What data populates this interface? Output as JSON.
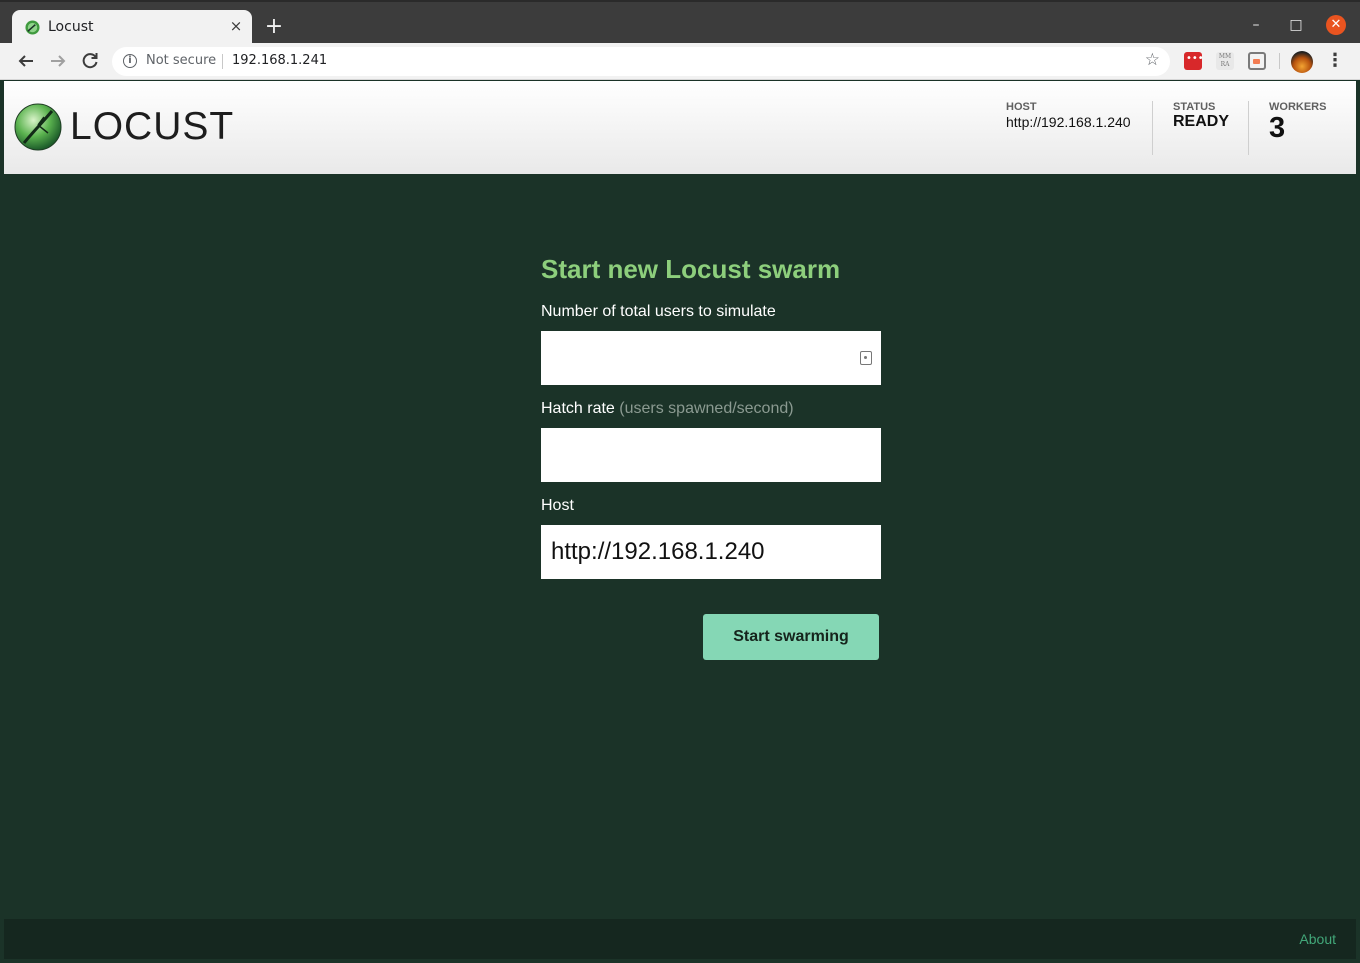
{
  "browser": {
    "tab_title": "Locust",
    "tab_close": "×",
    "new_tab": "+",
    "security_label": "Not secure",
    "url": "192.168.1.241",
    "window_controls": {
      "minimize": "–",
      "maximize": "□",
      "close": "✕"
    },
    "extensions": [
      "lastpass-icon",
      "mmra-extension-icon",
      "cast-icon"
    ],
    "ext2_text": "MM\nRA"
  },
  "header": {
    "logo_text": "LOCUST",
    "host": {
      "label": "HOST",
      "value": "http://192.168.1.240"
    },
    "status": {
      "label": "STATUS",
      "value": "READY"
    },
    "workers": {
      "label": "WORKERS",
      "value": "3"
    }
  },
  "form": {
    "title": "Start new Locust swarm",
    "users_label": "Number of total users to simulate",
    "users_value": "",
    "hatch_label": "Hatch rate",
    "hatch_hint": "(users spawned/second)",
    "hatch_value": "",
    "host_label": "Host",
    "host_value": "http://192.168.1.240",
    "submit_label": "Start swarming"
  },
  "footer": {
    "about_label": "About"
  },
  "colors": {
    "page_bg": "#1b3328",
    "title_green": "#8dcf7c",
    "button_bg": "#85d7b5",
    "about_link": "#42a779",
    "footer_bg": "#15271f"
  }
}
